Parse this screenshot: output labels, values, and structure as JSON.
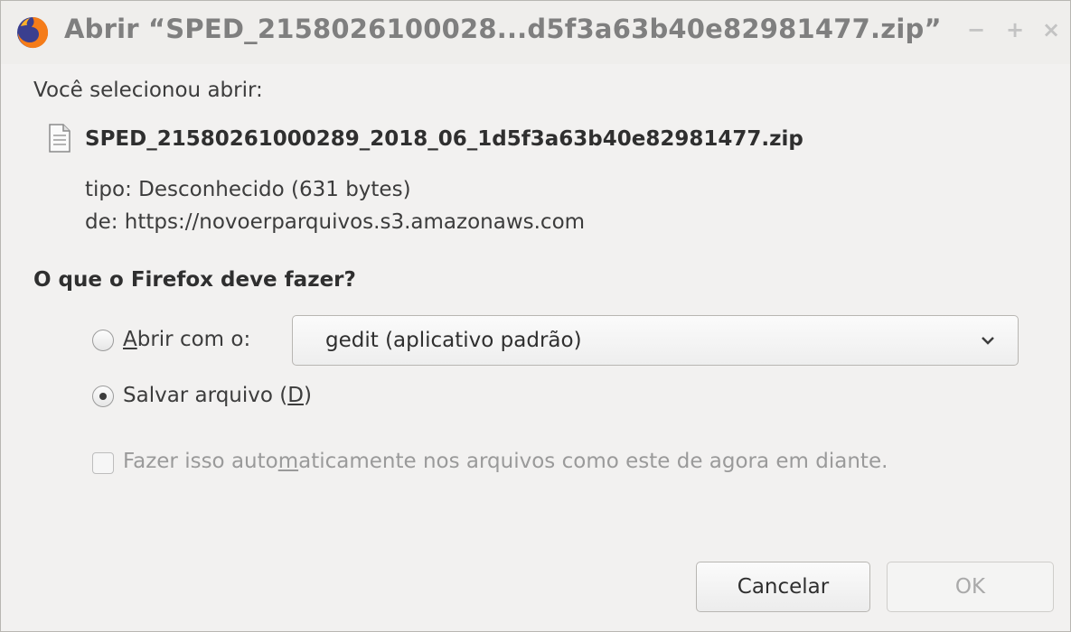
{
  "window": {
    "title": "Abrir “SPED_2158026100028...d5f3a63b40e82981477.zip”",
    "controls": {
      "minimize": "−",
      "maximize": "+",
      "close": "×"
    },
    "app_icon": "firefox-icon"
  },
  "intro": "Você selecionou abrir:",
  "file": {
    "icon": "document-icon",
    "name": "SPED_21580261000289_2018_06_1d5f3a63b40e82981477.zip",
    "type_line": "tipo: Desconhecido (631 bytes)",
    "from_line": "de: https://novoerparquivos.s3.amazonaws.com"
  },
  "question": "O que o Firefox deve fazer?",
  "options": {
    "open_with": {
      "label_underlined": "A",
      "label_rest": "brir com o:",
      "selected": false,
      "app": "gedit (aplicativo padrão)"
    },
    "save_file": {
      "label_before": "Salvar arquivo (",
      "label_underlined": "D",
      "label_after": ")",
      "selected": true
    }
  },
  "auto": {
    "before": "Fazer isso auto",
    "underlined": "m",
    "after": "aticamente nos arquivos como este de agora em diante.",
    "checked": false
  },
  "buttons": {
    "cancel": "Cancelar",
    "ok": "OK"
  },
  "colors": {
    "window_bg": "#f2f1f0",
    "title_text": "#7f7f7f",
    "text": "#3c3c3c",
    "disabled": "#9a9a9a"
  }
}
